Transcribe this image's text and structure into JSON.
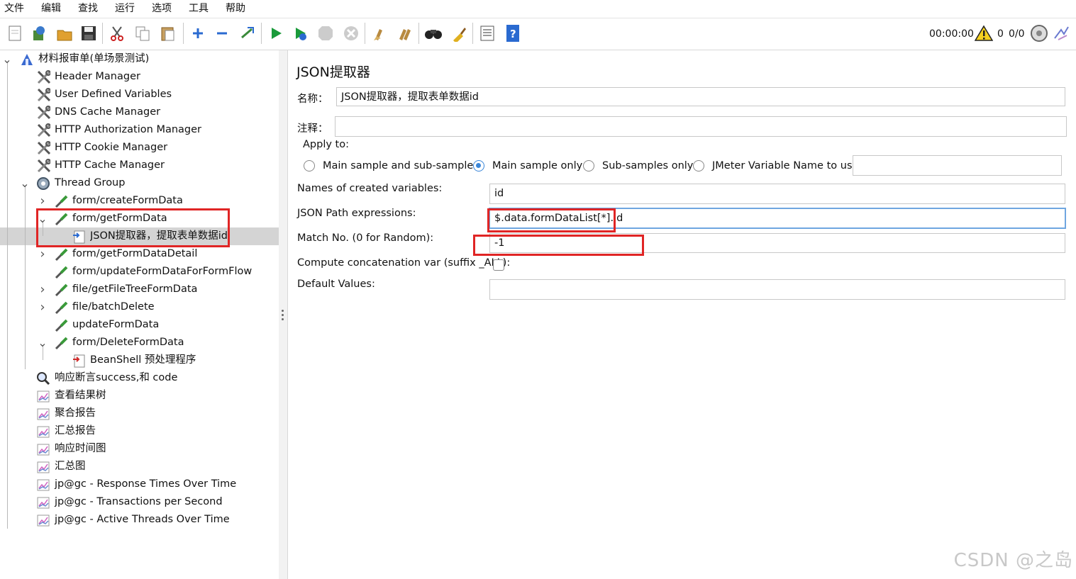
{
  "menu": [
    "文件",
    "编辑",
    "查找",
    "运行",
    "选项",
    "工具",
    "帮助"
  ],
  "toolbar": {
    "timer": "00:00:00",
    "warning_count": "0",
    "threads": "0/0",
    "icons": [
      "new-icon",
      "templates-icon",
      "open-icon",
      "save-icon",
      "cut-icon",
      "copy-icon",
      "paste-icon",
      "expand-icon",
      "collapse-icon",
      "toggle-icon",
      "start-icon",
      "start-no-pause-icon",
      "stop-icon",
      "shutdown-icon",
      "clear-icon",
      "clear-all-icon",
      "search-icon",
      "reset-search-icon",
      "function-helper-icon",
      "help-icon"
    ]
  },
  "tree": [
    {
      "label": "材料报审单(单场景测试)",
      "icon": "testplan-icon",
      "expanded": true
    },
    {
      "label": "Header Manager",
      "icon": "config-icon"
    },
    {
      "label": "User Defined Variables",
      "icon": "config-icon"
    },
    {
      "label": "DNS Cache Manager",
      "icon": "config-icon"
    },
    {
      "label": "HTTP Authorization Manager",
      "icon": "config-icon"
    },
    {
      "label": "HTTP Cookie Manager",
      "icon": "config-icon"
    },
    {
      "label": "HTTP Cache Manager",
      "icon": "config-icon"
    },
    {
      "label": "Thread Group",
      "icon": "thread-group-icon",
      "expanded": true
    },
    {
      "label": "form/createFormData",
      "icon": "sampler-icon",
      "expanded": false
    },
    {
      "label": "form/getFormData",
      "icon": "sampler-icon",
      "expanded": true
    },
    {
      "label": "JSON提取器，提取表单数据id",
      "icon": "post-processor-icon",
      "selected": true
    },
    {
      "label": "form/getFormDataDetail",
      "icon": "sampler-icon",
      "expanded": false
    },
    {
      "label": "form/updateFormDataForFormFlow",
      "icon": "sampler-icon"
    },
    {
      "label": "file/getFileTreeFormData",
      "icon": "sampler-icon",
      "expanded": false
    },
    {
      "label": "file/batchDelete",
      "icon": "sampler-icon",
      "expanded": false
    },
    {
      "label": "updateFormData",
      "icon": "sampler-icon"
    },
    {
      "label": "form/DeleteFormData",
      "icon": "sampler-icon",
      "expanded": true
    },
    {
      "label": "BeanShell 预处理程序",
      "icon": "pre-processor-icon"
    },
    {
      "label": "响应断言success,和 code",
      "icon": "assertion-icon"
    },
    {
      "label": "查看结果树",
      "icon": "listener-icon"
    },
    {
      "label": "聚合报告",
      "icon": "listener-icon"
    },
    {
      "label": "汇总报告",
      "icon": "listener-icon"
    },
    {
      "label": "响应时间图",
      "icon": "listener-icon"
    },
    {
      "label": "汇总图",
      "icon": "listener-icon"
    },
    {
      "label": "jp@gc - Response Times Over Time",
      "icon": "listener-icon"
    },
    {
      "label": "jp@gc - Transactions per Second",
      "icon": "listener-icon"
    },
    {
      "label": "jp@gc - Active Threads Over Time",
      "icon": "listener-icon"
    }
  ],
  "panel": {
    "title": "JSON提取器",
    "name_label": "名称：",
    "name_value": "JSON提取器，提取表单数据id",
    "comment_label": "注释：",
    "comment_value": "",
    "apply_to_label": "Apply to:",
    "apply_options": [
      "Main sample and sub-samples",
      "Main sample only",
      "Sub-samples only",
      "JMeter Variable Name to use"
    ],
    "apply_selected": "Main sample only",
    "jmeter_var_value": "",
    "names_label": "Names of created variables:",
    "names_value": "id",
    "jsonpath_label": "JSON Path expressions:",
    "jsonpath_value": "$.data.formDataList[*].id",
    "matchno_label": "Match No. (0 for Random):",
    "matchno_value": "-1",
    "concat_label": "Compute concatenation var (suffix _ALL):",
    "concat_checked": false,
    "default_label": "Default Values:",
    "default_value": ""
  },
  "watermark": "CSDN @之岛",
  "colors": {
    "highlight_box": "#e02525",
    "selected_row": "#d4d4d4",
    "radio_selected": "#3a86d8"
  }
}
